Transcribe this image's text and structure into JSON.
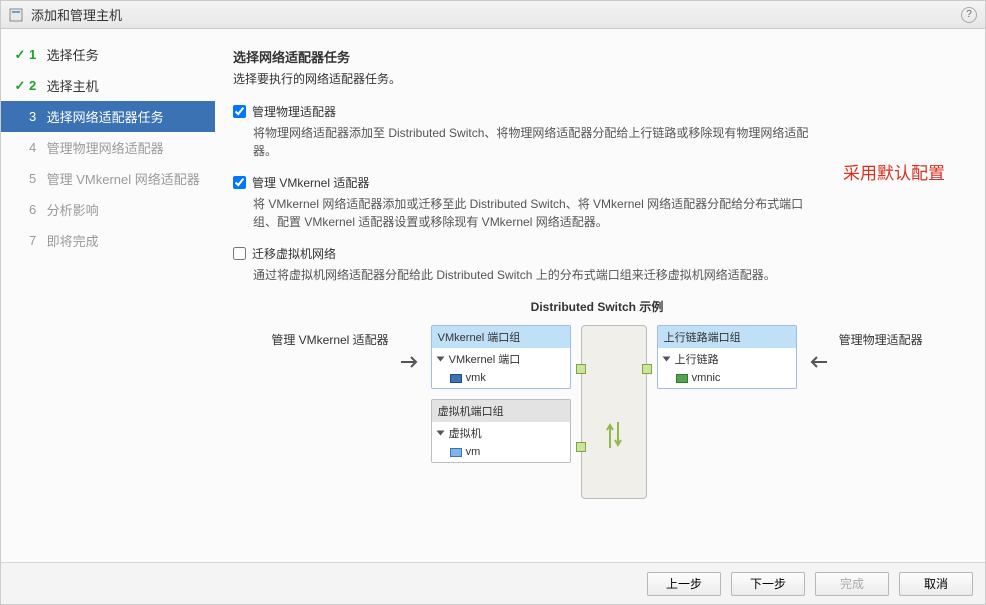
{
  "window": {
    "title": "添加和管理主机"
  },
  "help": {
    "glyph": "?"
  },
  "steps": [
    {
      "num": "1",
      "label": "选择任务",
      "state": "done"
    },
    {
      "num": "2",
      "label": "选择主机",
      "state": "done"
    },
    {
      "num": "3",
      "label": "选择网络适配器任务",
      "state": "active"
    },
    {
      "num": "4",
      "label": "管理物理网络适配器",
      "state": "future"
    },
    {
      "num": "5",
      "label": "管理 VMkernel 网络适配器",
      "state": "future"
    },
    {
      "num": "6",
      "label": "分析影响",
      "state": "future"
    },
    {
      "num": "7",
      "label": "即将完成",
      "state": "future"
    }
  ],
  "page": {
    "heading": "选择网络适配器任务",
    "sub": "选择要执行的网络适配器任务。"
  },
  "opts": [
    {
      "checked": true,
      "label": "管理物理适配器",
      "desc": "将物理网络适配器添加至 Distributed Switch、将物理网络适配器分配给上行链路或移除现有物理网络适配器。"
    },
    {
      "checked": true,
      "label": "管理 VMkernel 适配器",
      "desc": "将 VMkernel 网络适配器添加或迁移至此 Distributed Switch、将 VMkernel 网络适配器分配给分布式端口组、配置 VMkernel 适配器设置或移除现有 VMkernel 网络适配器。"
    },
    {
      "checked": false,
      "label": "迁移虚拟机网络",
      "desc": "通过将虚拟机网络适配器分配给此 Distributed Switch 上的分布式端口组来迁移虚拟机网络适配器。"
    }
  ],
  "annotation": "采用默认配置",
  "diagram": {
    "title": "Distributed Switch 示例",
    "left_label": "管理 VMkernel 适配器",
    "right_label": "管理物理适配器",
    "vmk_group": {
      "header": "VMkernel 端口组",
      "row": "VMkernel 端口",
      "item": "vmk"
    },
    "vm_group": {
      "header": "虚拟机端口组",
      "row": "虚拟机",
      "item": "vm"
    },
    "uplink_group": {
      "header": "上行链路端口组",
      "row": "上行链路",
      "item": "vmnic"
    }
  },
  "buttons": {
    "back": "上一步",
    "next": "下一步",
    "finish": "完成",
    "cancel": "取消"
  },
  "check_glyph": "✓"
}
